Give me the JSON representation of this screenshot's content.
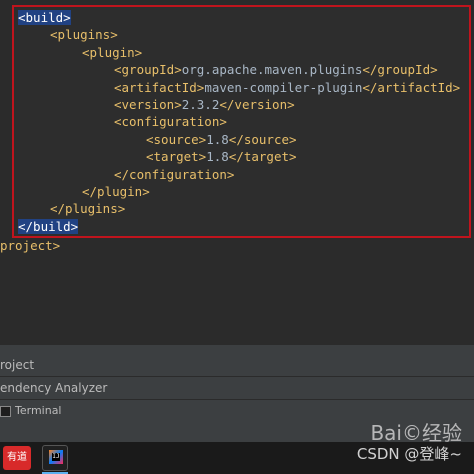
{
  "code_lines": [
    {
      "indent": 0,
      "open": "<build>",
      "selected": true
    },
    {
      "indent": 1,
      "open": "<plugins>"
    },
    {
      "indent": 2,
      "open": "<plugin>"
    },
    {
      "indent": 3,
      "open": "<groupId>",
      "text": "org.apache.maven.plugins",
      "close": "</groupId>"
    },
    {
      "indent": 3,
      "open": "<artifactId>",
      "text": "maven-compiler-plugin",
      "close": "</artifactId>"
    },
    {
      "indent": 3,
      "open": "<version>",
      "text": "2.3.2",
      "close": "</version>"
    },
    {
      "indent": 3,
      "open": "<configuration>"
    },
    {
      "indent": 4,
      "open": "<source>",
      "text": "1.8",
      "close": "</source>"
    },
    {
      "indent": 4,
      "open": "<target>",
      "text": "1.8",
      "close": "</target>"
    },
    {
      "indent": 3,
      "open": "</configuration>"
    },
    {
      "indent": 2,
      "open": "</plugin>"
    },
    {
      "indent": 1,
      "open": "</plugins>"
    },
    {
      "indent": 0,
      "open": "</build>",
      "selected": true
    }
  ],
  "trailing_line": "project>",
  "panel": {
    "row1_label": "roject",
    "row2_label": "endency Analyzer",
    "row3_label": "Terminal"
  },
  "taskbar": {
    "app1_label": "有道"
  },
  "watermark": {
    "line1": "Bai©经验",
    "line2": "CSDN @登峰~"
  },
  "colors": {
    "highlight_border": "#c0141d",
    "tag": "#e8bf6a",
    "text": "#a9b7c6",
    "selection": "#214283"
  }
}
